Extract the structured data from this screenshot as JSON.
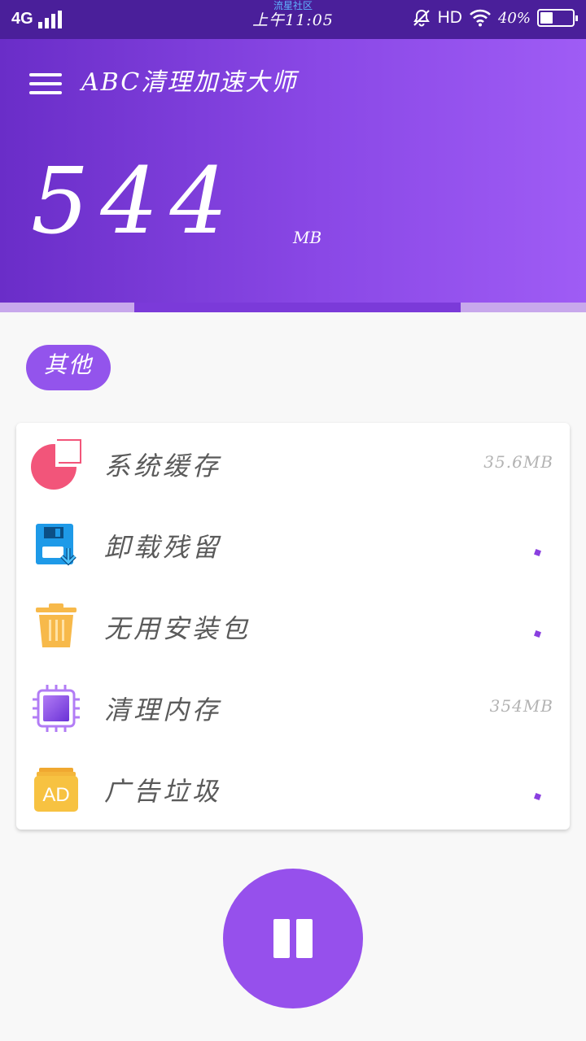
{
  "status_bar": {
    "network": "4G",
    "watermark": "流星社区",
    "time": "上午11:05",
    "hd": "HD",
    "battery_percent": "40%",
    "battery_level": 0.4
  },
  "header": {
    "title": "ABC清理加速大师",
    "total_value": "544",
    "total_unit": "MB",
    "scan_progress": 0.77
  },
  "category_tag": "其他",
  "items": [
    {
      "label": "系统缓存",
      "size": "35.6MB",
      "icon": "pie-chart-icon"
    },
    {
      "label": "卸载残留",
      "size": "",
      "icon": "download-floppy-icon"
    },
    {
      "label": "无用安装包",
      "size": "",
      "icon": "trash-bin-icon"
    },
    {
      "label": "清理内存",
      "size": "354MB",
      "icon": "memory-chip-icon"
    },
    {
      "label": "广告垃圾",
      "size": "",
      "icon": "ad-stack-icon"
    }
  ],
  "ad_icon_text": "AD",
  "colors": {
    "accent": "#9650ec",
    "header_start": "#6a2dc8",
    "header_end": "#9f5cf5",
    "pie": "#f2557a",
    "download": "#1e9ae8",
    "trash": "#f7b94a",
    "chip": "#8a4fe6",
    "ad": "#f7c241"
  },
  "pause_icon": "pause-icon"
}
